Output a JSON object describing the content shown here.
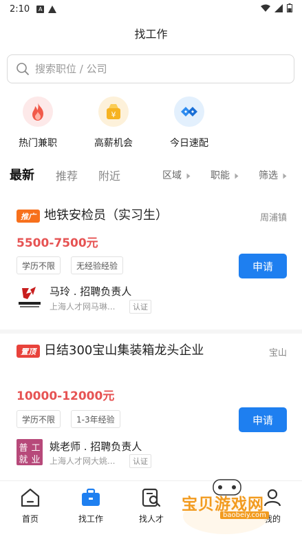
{
  "status_bar": {
    "time": "2:10"
  },
  "header": {
    "title": "找工作"
  },
  "search": {
    "placeholder": "搜索职位 / 公司"
  },
  "categories": [
    {
      "label": "热门兼职",
      "icon": "fire-icon"
    },
    {
      "label": "高薪机会",
      "icon": "money-bag-icon"
    },
    {
      "label": "今日速配",
      "icon": "match-icon"
    }
  ],
  "tabs": [
    {
      "label": "最新",
      "active": true
    },
    {
      "label": "推荐",
      "active": false
    },
    {
      "label": "附近",
      "active": false
    }
  ],
  "filters": [
    {
      "label": "区域"
    },
    {
      "label": "职能"
    },
    {
      "label": "筛选"
    }
  ],
  "jobs": [
    {
      "badge": "推广",
      "badge_color": "#f7701c",
      "title": "地铁安检员（实习生）",
      "location": "周浦镇",
      "salary": "5500-7500元",
      "tags": [
        "学历不限",
        "无经验经验"
      ],
      "apply_label": "申请",
      "recruiter_name": "马玲 . 招聘负责人",
      "recruiter_company": "上海人才网马琳...",
      "cert_label": "认证"
    },
    {
      "badge": "置顶",
      "badge_color": "#e8423b",
      "title": "日结300宝山集装箱龙头企业",
      "location": "宝山",
      "salary": "10000-12000元",
      "tags": [
        "学历不限",
        "1-3年经验"
      ],
      "apply_label": "申请",
      "recruiter_name": "姚老师 . 招聘负责人",
      "recruiter_company": "上海人才网大姚...",
      "cert_label": "认证"
    }
  ],
  "bottom_nav": [
    {
      "label": "首页",
      "icon": "home-icon",
      "active": false
    },
    {
      "label": "找工作",
      "icon": "briefcase-icon",
      "active": true
    },
    {
      "label": "找人才",
      "icon": "search-doc-icon",
      "active": false
    },
    {
      "label": "我的",
      "icon": "user-icon",
      "active": false
    }
  ],
  "watermark": {
    "text": "宝贝游戏网",
    "url": "baobeiy.com"
  },
  "colors": {
    "accent": "#1e7ff0",
    "salary": "#e65353"
  }
}
